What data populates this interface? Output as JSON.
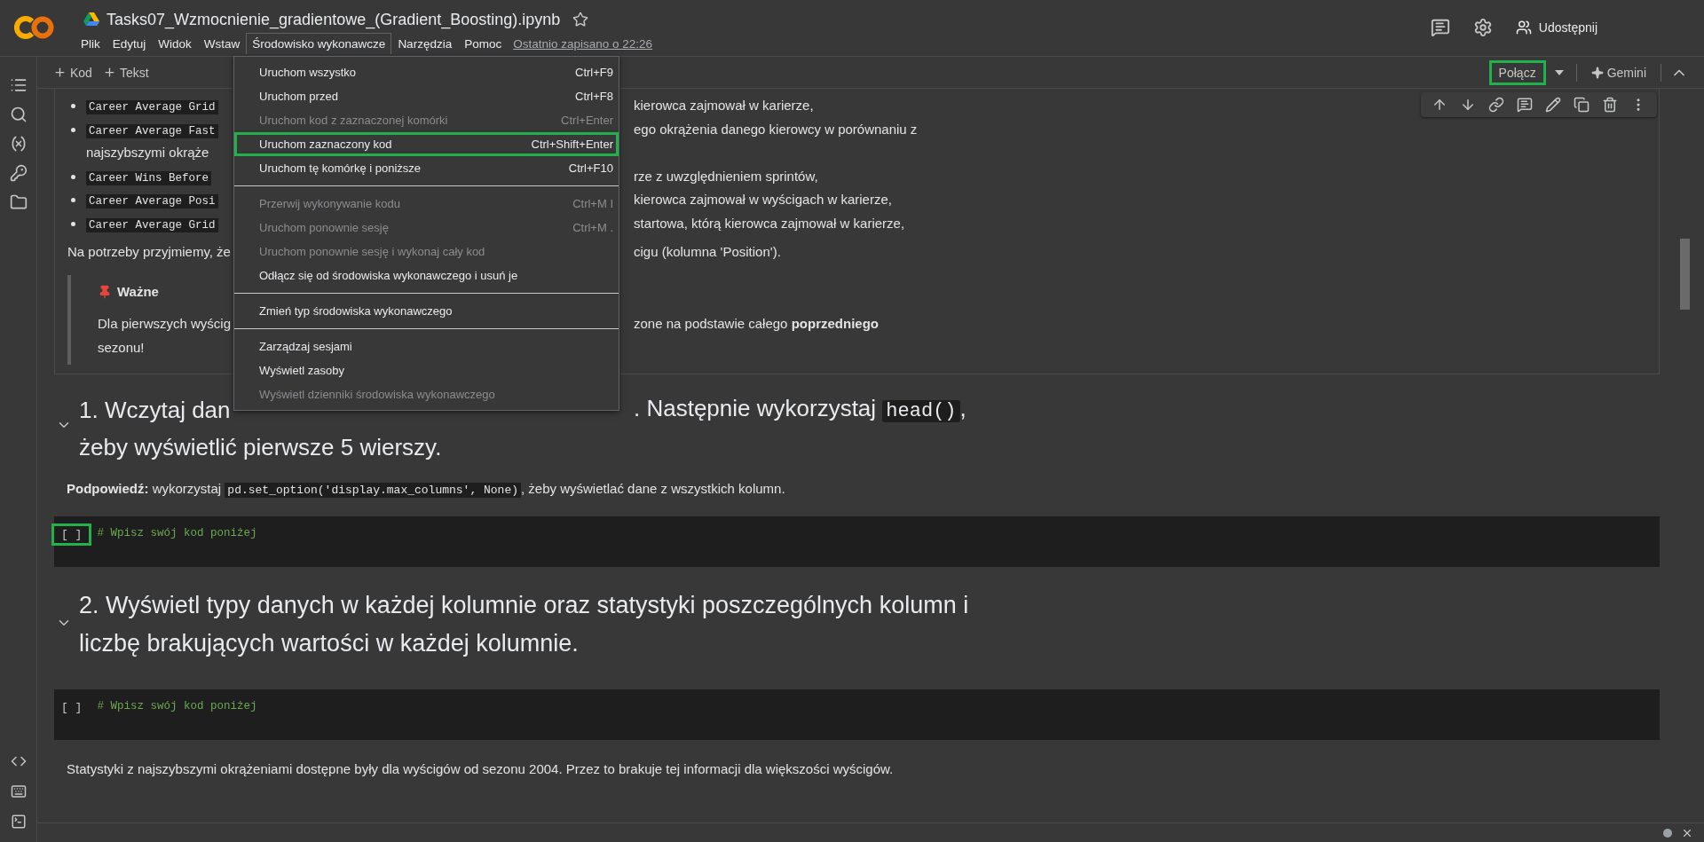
{
  "app": {
    "title": "Tasks07_Wzmocnienie_gradientowe_(Gradient_Boosting).ipynb",
    "starred": false,
    "last_saved": "Ostatnio zapisano o 22:26",
    "share": "Udostępnij"
  },
  "menubar": [
    {
      "label": "Plik",
      "selected": false
    },
    {
      "label": "Edytuj",
      "selected": false
    },
    {
      "label": "Widok",
      "selected": false
    },
    {
      "label": "Wstaw",
      "selected": false
    },
    {
      "label": "Środowisko wykonawcze",
      "selected": true
    },
    {
      "label": "Narzędzia",
      "selected": false
    },
    {
      "label": "Pomoc",
      "selected": false
    }
  ],
  "toolbar": {
    "add_code": "Kod",
    "add_text": "Tekst",
    "connect": {
      "label": "Połącz",
      "highlighted": true
    },
    "gemini": "Gemini"
  },
  "runtime_menu": [
    [
      {
        "label": "Uruchom wszystko",
        "shortcut": "Ctrl+F9",
        "disabled": false,
        "highlighted": false
      },
      {
        "label": "Uruchom przed",
        "shortcut": "Ctrl+F8",
        "disabled": false,
        "highlighted": false
      },
      {
        "label": "Uruchom kod z zaznaczonej komórki",
        "shortcut": "Ctrl+Enter",
        "disabled": true,
        "highlighted": false
      },
      {
        "label": "Uruchom zaznaczony kod",
        "shortcut": "Ctrl+Shift+Enter",
        "disabled": false,
        "highlighted": true
      },
      {
        "label": "Uruchom tę komórkę i poniższe",
        "shortcut": "Ctrl+F10",
        "disabled": false,
        "highlighted": false
      }
    ],
    [
      {
        "label": "Przerwij wykonywanie kodu",
        "shortcut": "Ctrl+M I",
        "disabled": true,
        "highlighted": false
      },
      {
        "label": "Uruchom ponownie sesję",
        "shortcut": "Ctrl+M .",
        "disabled": true,
        "highlighted": false
      },
      {
        "label": "Uruchom ponownie sesję i wykonaj cały kod",
        "disabled": true,
        "highlighted": false
      },
      {
        "label": "Odłącz się od środowiska wykonawczego i usuń je",
        "disabled": false,
        "highlighted": false
      }
    ],
    [
      {
        "label": "Zmień typ środowiska wykonawczego",
        "disabled": false,
        "highlighted": false
      }
    ],
    [
      {
        "label": "Zarządzaj sesjami",
        "disabled": false,
        "highlighted": false
      },
      {
        "label": "Wyświetl zasoby",
        "disabled": false,
        "highlighted": false
      },
      {
        "label": "Wyświetl dzienniki środowiska wykonawczego",
        "disabled": true,
        "highlighted": false
      }
    ]
  ],
  "cells": [
    {
      "kind": "markdown",
      "bullets": [
        {
          "code": "Career Average Grid",
          "text": "kierowca zajmował w karierze,"
        },
        {
          "code": "Career Average Fast",
          "text": "ego okrążenia danego kierowcy w porównaniu z",
          "wrap": "najszybszymi okrąże"
        },
        {
          "code": "Career Wins Before",
          "text": "rze z uwzględnieniem sprintów,"
        },
        {
          "code": "Career Average Posi",
          "text": "kierowca zajmował w wyścigach w karierze,"
        },
        {
          "code": "Career Average Grid",
          "text": "startowa, którą kierowca zajmował w karierze,"
        }
      ],
      "paragraph": {
        "left": "Na potrzeby przyjmiemy, że",
        "right": "cigu (kolumna 'Position')."
      },
      "callout": {
        "title": "Ważne",
        "left": "Dla pierwszych wyścig",
        "right": "zone na podstawie całego **poprzedniego**",
        "last": "sezonu!"
      }
    },
    {
      "kind": "heading",
      "expanded": true,
      "left": "1. Wczytaj dan",
      "right": ". Następnie wykorzystaj",
      "code": "head()",
      "tail": ",",
      "line2": "żeby wyświetlić pierwsze 5 wierszy."
    },
    {
      "kind": "hint",
      "label": "Podpowiedź:",
      "before": "wykorzystaj",
      "code": "pd.set_option('display.max_columns', None)",
      "after": ", żeby wyświetlać dane z wszystkich kolumn."
    },
    {
      "kind": "code",
      "run": "[ ]",
      "highlighted": true,
      "code": "# Wpisz swój kod poniżej"
    },
    {
      "kind": "heading2",
      "expanded": true,
      "text": "2. Wyświetl typy danych w każdej kolumnie oraz statystyki poszczególnych kolumn i liczbę brakujących wartości w każdej kolumnie."
    },
    {
      "kind": "code",
      "run": "[ ]",
      "highlighted": false,
      "code": "# Wpisz swój kod poniżej"
    },
    {
      "kind": "text",
      "text": "Statystyki z najszybszymi okrążeniami dostępne były dla wyścigów od sezonu 2004. Przez to brakuje tej informacji dla większości wyścigów."
    }
  ]
}
